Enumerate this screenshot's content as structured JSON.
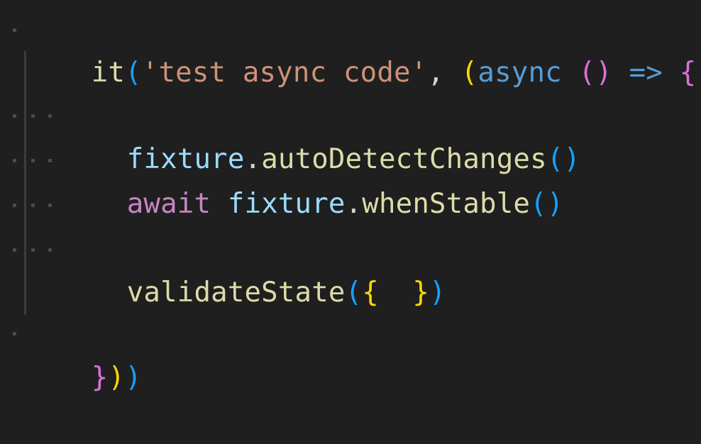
{
  "editor": {
    "lines": [
      {
        "tokens": [
          {
            "text": "it",
            "kind": "function"
          },
          {
            "text": "(",
            "kind": "bracket-3"
          },
          {
            "text": "'test async code'",
            "kind": "string"
          },
          {
            "text": ", ",
            "kind": "punctuation"
          },
          {
            "text": "(",
            "kind": "bracket-1"
          },
          {
            "text": "async ",
            "kind": "keyword"
          },
          {
            "text": "()",
            "kind": "bracket-2"
          },
          {
            "text": " => ",
            "kind": "keyword"
          },
          {
            "text": "{",
            "kind": "bracket-2"
          }
        ]
      },
      {
        "tokens": [
          {
            "text": "fixture",
            "kind": "variable"
          },
          {
            "text": ".",
            "kind": "punctuation"
          },
          {
            "text": "autoDetectChanges",
            "kind": "function"
          },
          {
            "text": "()",
            "kind": "bracket-3"
          }
        ]
      },
      {
        "tokens": [
          {
            "text": "await ",
            "kind": "control"
          },
          {
            "text": "fixture",
            "kind": "variable"
          },
          {
            "text": ".",
            "kind": "punctuation"
          },
          {
            "text": "whenStable",
            "kind": "function"
          },
          {
            "text": "()",
            "kind": "bracket-3"
          }
        ]
      },
      {
        "tokens": [
          {
            "text": "validateState",
            "kind": "function"
          },
          {
            "text": "(",
            "kind": "bracket-3"
          },
          {
            "text": "{  ",
            "kind": "bracket-1"
          },
          {
            "text": "}",
            "kind": "bracket-1"
          },
          {
            "text": ")",
            "kind": "bracket-3"
          }
        ]
      },
      {
        "tokens": [
          {
            "text": "}",
            "kind": "bracket-2"
          },
          {
            "text": ")",
            "kind": "bracket-1"
          },
          {
            "text": ")",
            "kind": "bracket-3"
          }
        ]
      }
    ]
  },
  "colors": {
    "background": "#1f1f1f",
    "function": "#dcdcaa",
    "string": "#ce9178",
    "keyword": "#569cd6",
    "variable": "#9cdcfe",
    "control": "#c586c0",
    "bracket_level_1": "#ffd700",
    "bracket_level_2": "#da70d6",
    "bracket_level_3": "#179fff",
    "whitespace_dot": "#4b4b4b"
  }
}
